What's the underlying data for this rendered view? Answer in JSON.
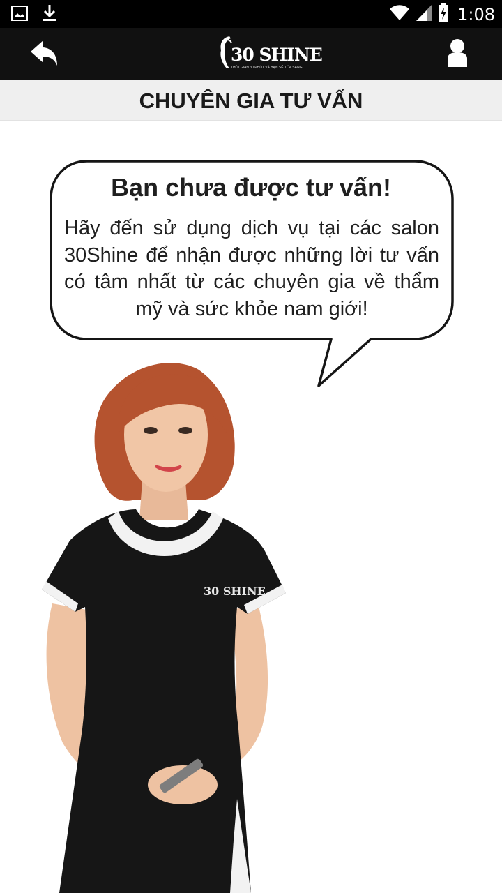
{
  "status_bar": {
    "time": "1:08",
    "left_icons": [
      "image-icon",
      "download-icon"
    ],
    "right_icons": [
      "wifi-icon",
      "signal-icon",
      "battery-icon"
    ]
  },
  "app_bar": {
    "back_icon": "back-arrow-icon",
    "logo": {
      "text": "30 SHINE",
      "tagline": "THỜI GIAN 30 PHÚT VÀ BẠN SẼ TỎA SÁNG"
    },
    "profile_icon": "user-icon"
  },
  "page": {
    "title": "CHUYÊN GIA TƯ VẤN"
  },
  "bubble": {
    "title": "Bạn chưa được tư vấn!",
    "message": "Hãy đến sử dụng dịch vụ tại các salon 30Shine để nhận được những lời tư vấn có tâm nhất từ các chuyên gia về thẩm mỹ và sức khỏe nam giới!"
  },
  "illustration": {
    "shirt_logo": "30 SHINE"
  },
  "colors": {
    "app_bar": "#111111",
    "status_bar": "#000000",
    "sub_header": "#efefef",
    "hair": "#b5532f",
    "dress": "#161616",
    "trim": "#f2f2f2"
  }
}
